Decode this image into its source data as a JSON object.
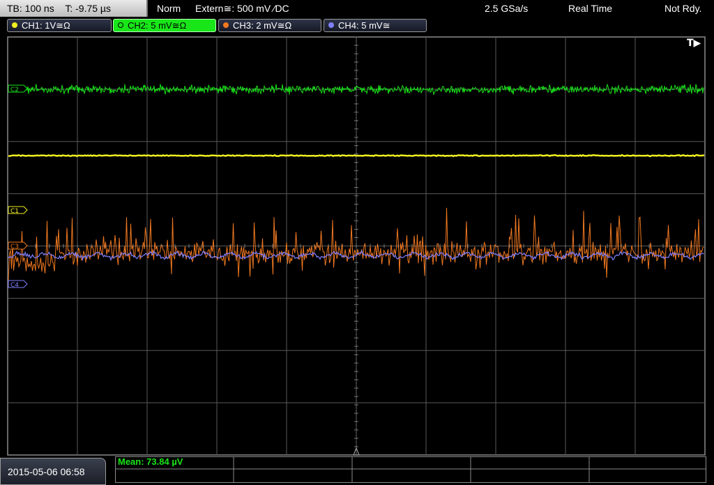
{
  "header": {
    "timebase": "TB: 100 ns",
    "trigger_time": "T: -9.75 µs",
    "trigger_mode": "Norm",
    "trigger_source": "Extern≅: 500 mV ⁄DC",
    "sample_rate": "2.5 GSa/s",
    "acq_mode": "Real Time",
    "status": "Not Rdy."
  },
  "channels": [
    {
      "label": "CH1: 1V≅Ω",
      "color": "#f0f020",
      "active": false
    },
    {
      "label": "CH2: 5 mV≅Ω",
      "color": "#19e619",
      "active": true
    },
    {
      "label": "CH3: 2 mV≅Ω",
      "color": "#f07820",
      "active": false
    },
    {
      "label": "CH4: 5 mV≅",
      "color": "#8080ff",
      "active": false
    }
  ],
  "markers": {
    "trigger_pos": "T▶",
    "c1": "C1",
    "c2": "C2",
    "c3": "C3",
    "c4": "C4"
  },
  "footer": {
    "datetime": "2015-05-06 06:58",
    "measurement": "Mean: 73.84 µV"
  },
  "colors": {
    "grid": "#5a5a5a",
    "ch1": "#f0f020",
    "ch2": "#19e619",
    "ch3": "#f07820",
    "ch4": "#8080ff"
  },
  "icons": [
    "trigger-position-icon",
    "channel-dot-icon",
    "ground-marker-icon"
  ]
}
